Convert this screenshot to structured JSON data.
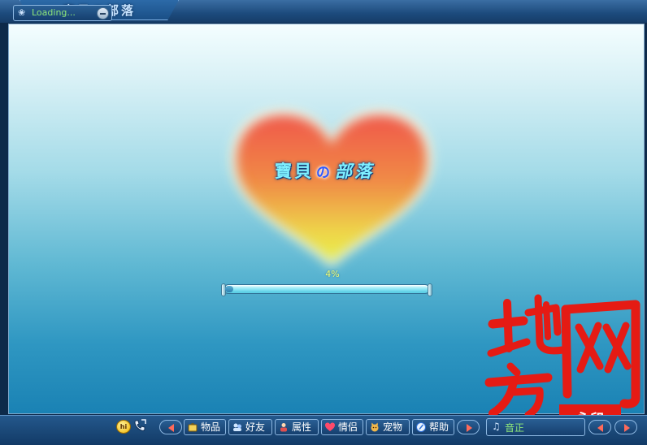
{
  "window": {
    "title": "寶貝の部落"
  },
  "logo": {
    "part1": "寶貝",
    "part2": "の",
    "part3": "部落"
  },
  "loading": {
    "percent_text": "4%",
    "progress": 0.04
  },
  "status": {
    "text": "Loading..."
  },
  "toolbar": {
    "hi_label": "hi",
    "items": [
      {
        "label": "物品"
      },
      {
        "label": "好友"
      },
      {
        "label": "属性"
      },
      {
        "label": "情侣"
      },
      {
        "label": "宠物"
      },
      {
        "label": "帮助"
      }
    ],
    "music_text": "音正"
  },
  "watermark": {
    "chars": [
      "地",
      "方",
      "网"
    ],
    "stamp": "永印"
  },
  "colors": {
    "frame": "#1c4a7c",
    "heart_top": "#f0584a",
    "heart_bottom": "#e9f04a",
    "progress_text": "#f4ff74",
    "status_text": "#8ee77a",
    "watermark": "#e51b14"
  }
}
